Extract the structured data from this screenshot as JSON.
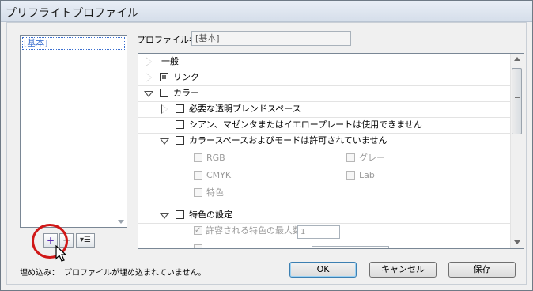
{
  "window": {
    "title": "プリフライトプロファイル"
  },
  "profiles": {
    "items": [
      "[基本]"
    ]
  },
  "toolbar": {
    "add": "+",
    "remove": "−",
    "menu": "▾☰"
  },
  "profile_name": {
    "label": "プロファイル名：",
    "value": "[基本]"
  },
  "tree": {
    "general": "一般",
    "link": "リンク",
    "color": "カラー",
    "blend_space": "必要な透明ブレンドスペース",
    "cmy_plate": "シアン、マゼンタまたはイエロープレートは使用できません",
    "color_spaces": "カラースペースおよびモードは許可されていません",
    "rgb": "RGB",
    "gray": "グレー",
    "cmyk": "CMYK",
    "lab": "Lab",
    "spot": "特色",
    "spot_settings": "特色の設定",
    "max_spots_label": "許容される特色の最大数：",
    "max_spots_value": "1"
  },
  "footer": {
    "embed_label": "埋め込み：",
    "embed_status": "プロファイルが埋め込まれていません。",
    "ok": "OK",
    "cancel": "キャンセル",
    "save": "保存"
  }
}
